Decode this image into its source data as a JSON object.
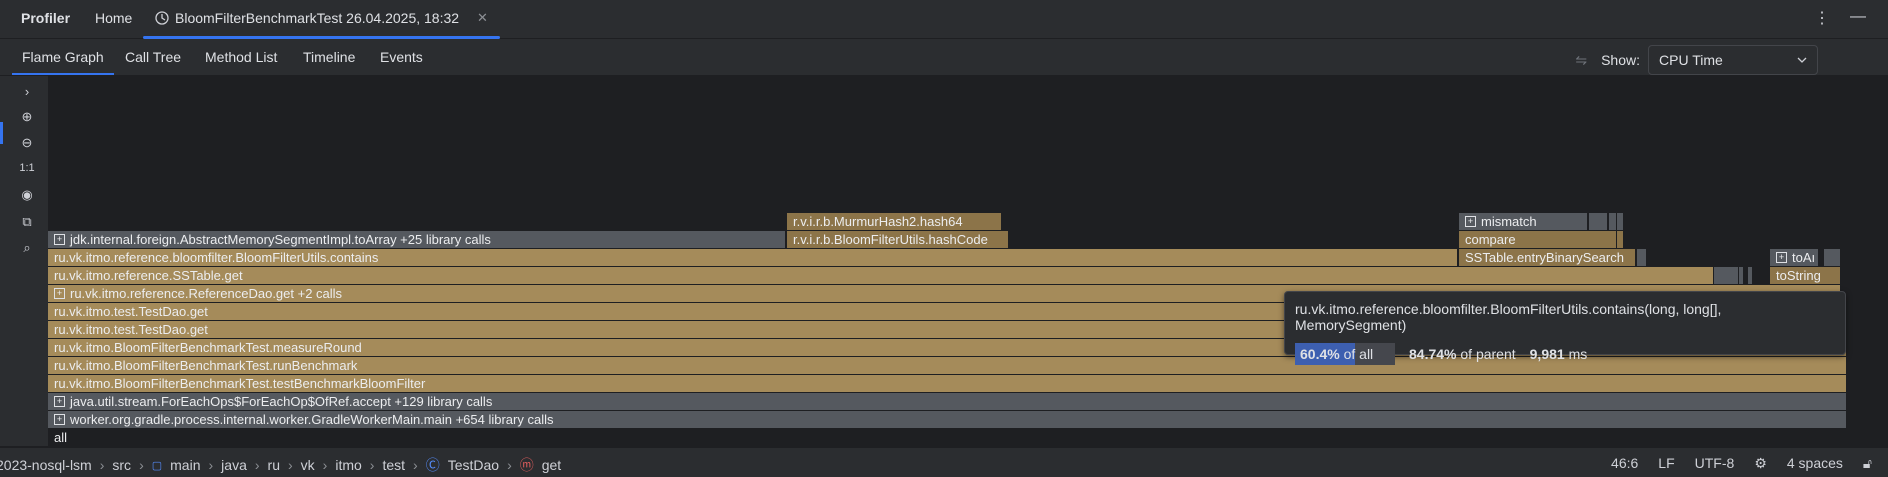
{
  "app": {
    "title": "Profiler"
  },
  "tabs": {
    "home": "Home",
    "test": "BloomFilterBenchmarkTest 26.04.2025, 18:32"
  },
  "view_tabs": [
    "Flame Graph",
    "Call Tree",
    "Method List",
    "Timeline",
    "Events"
  ],
  "show": {
    "label": "Show:",
    "value": "CPU Time"
  },
  "left_tools": [
    "chevron-right-icon",
    "zoom-in-icon",
    "zoom-out-icon",
    "1:1",
    "eye-icon",
    "camera-icon",
    "search-icon"
  ],
  "flame": {
    "frames": {
      "murmur": "r.v.i.r.b.MurmurHash2.hash64",
      "hashcode": "r.v.i.r.b.BloomFilterUtils.hashCode",
      "mismatch": "mismatch",
      "compare": "compare",
      "entrybs": "SSTable.entryBinarySearch",
      "toarray_short": "toAı",
      "tostring": "toString",
      "tostring2": "toStri",
      "jdk": "jdk.internal.foreign.AbstractMemorySegmentImpl.toArray +25 library calls",
      "contains": "ru.vk.itmo.reference.bloomfilter.BloomFilterUtils.contains",
      "sstable_get": "ru.vk.itmo.reference.SSTable.get",
      "refdao_get": "ru.vk.itmo.reference.ReferenceDao.get +2 calls",
      "testdao_get1": "ru.vk.itmo.test.TestDao.get",
      "testdao_get2": "ru.vk.itmo.test.TestDao.get",
      "measure": "ru.vk.itmo.BloomFilterBenchmarkTest.measureRound",
      "run": "ru.vk.itmo.BloomFilterBenchmarkTest.runBenchmark",
      "testbench": "ru.vk.itmo.BloomFilterBenchmarkTest.testBenchmarkBloomFilter",
      "foreach": "java.util.stream.ForEachOps$ForEachOp$OfRef.accept +129 library calls",
      "worker": "worker.org.gradle.process.internal.worker.GradleWorkerMain.main +654 library calls",
      "all": "all"
    }
  },
  "tooltip": {
    "title": "ru.vk.itmo.reference.bloomfilter.BloomFilterUtils.contains(long, long[], MemorySegment)",
    "pct_all_value": "60.4%",
    "pct_all_suffix": "of all",
    "pct_all_fraction": 0.604,
    "pct_parent_value": "84.74%",
    "pct_parent_suffix": "of parent",
    "time_value": "9,981",
    "time_unit": "ms"
  },
  "status": {
    "crumbs": [
      "2023-nosql-lsm",
      "src",
      "main",
      "java",
      "ru",
      "vk",
      "itmo",
      "test",
      "TestDao",
      "get"
    ],
    "position": "46:6",
    "line_ending": "LF",
    "encoding": "UTF-8",
    "indent": "4 spaces"
  },
  "colors": {
    "accent": "#3574f0",
    "frame": "#a58b5a",
    "library": "#55595f"
  }
}
